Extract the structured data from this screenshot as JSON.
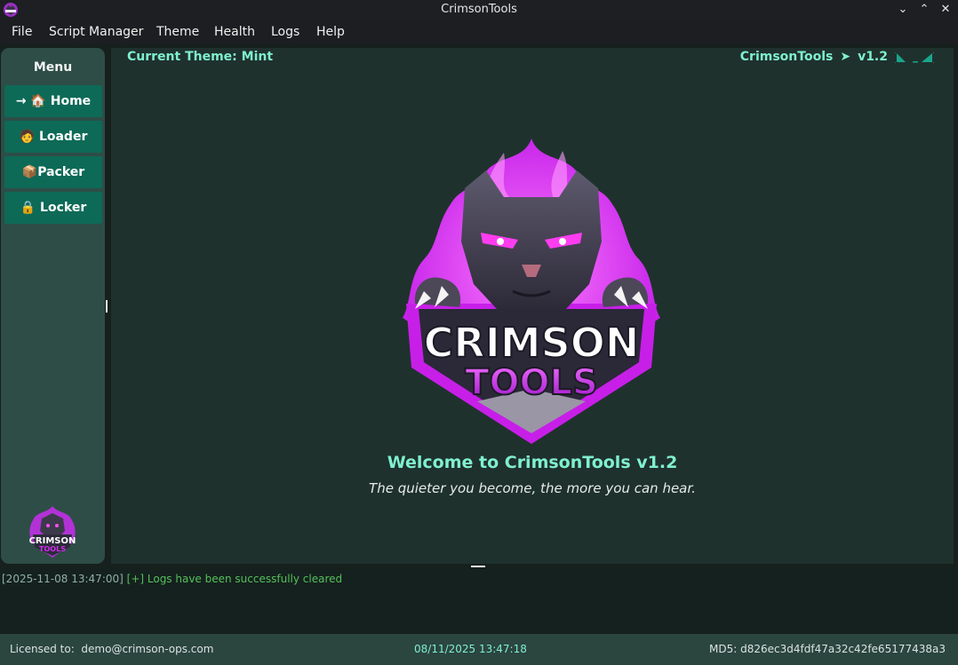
{
  "window": {
    "title": "CrimsonTools",
    "controls": {
      "minimize": "⌄",
      "maximize": "⌃",
      "close": "✕"
    }
  },
  "menubar": {
    "items": [
      "File",
      "Script Manager",
      "Theme",
      "Health",
      "Logs",
      "Help"
    ]
  },
  "sidebar": {
    "title": "Menu",
    "items": [
      {
        "label": "→ 🏠 Home",
        "icon": "home-icon"
      },
      {
        "label": "🧑 Loader",
        "icon": "loader-icon"
      },
      {
        "label": "📦Packer",
        "icon": "package-icon"
      },
      {
        "label": "🔒 Locker",
        "icon": "lock-icon"
      }
    ],
    "logo_text_top": "CRIMSON",
    "logo_text_bottom": "TOOLS"
  },
  "main": {
    "theme_label": "Current Theme: Mint",
    "brand_name": "CrimsonTools",
    "brand_arrow": "➤",
    "version": "v1.2",
    "logo_text_top": "CRIMSON",
    "logo_text_bottom": "TOOLS",
    "welcome": "Welcome to CrimsonTools v1.2",
    "tagline": "The quieter you become, the more you can hear."
  },
  "log": {
    "entries": [
      {
        "timestamp": "[2025-11-08 13:47:00]",
        "message": "[+] Logs have been successfully cleared"
      }
    ]
  },
  "status": {
    "licensed_label": "Licensed to:",
    "licensed_to": "demo@crimson-ops.com",
    "datetime": "08/11/2025 13:47:18",
    "md5_label": "MD5:",
    "md5": "d826ec3d4fdf47a32c42fe65177438a3"
  },
  "colors": {
    "accent": "#7ff0cd",
    "button": "#0d6a57",
    "sidebar": "#2e4d47",
    "panel": "#1f312d",
    "logo_purple": "#d22cf0",
    "log_success": "#54c05a"
  }
}
